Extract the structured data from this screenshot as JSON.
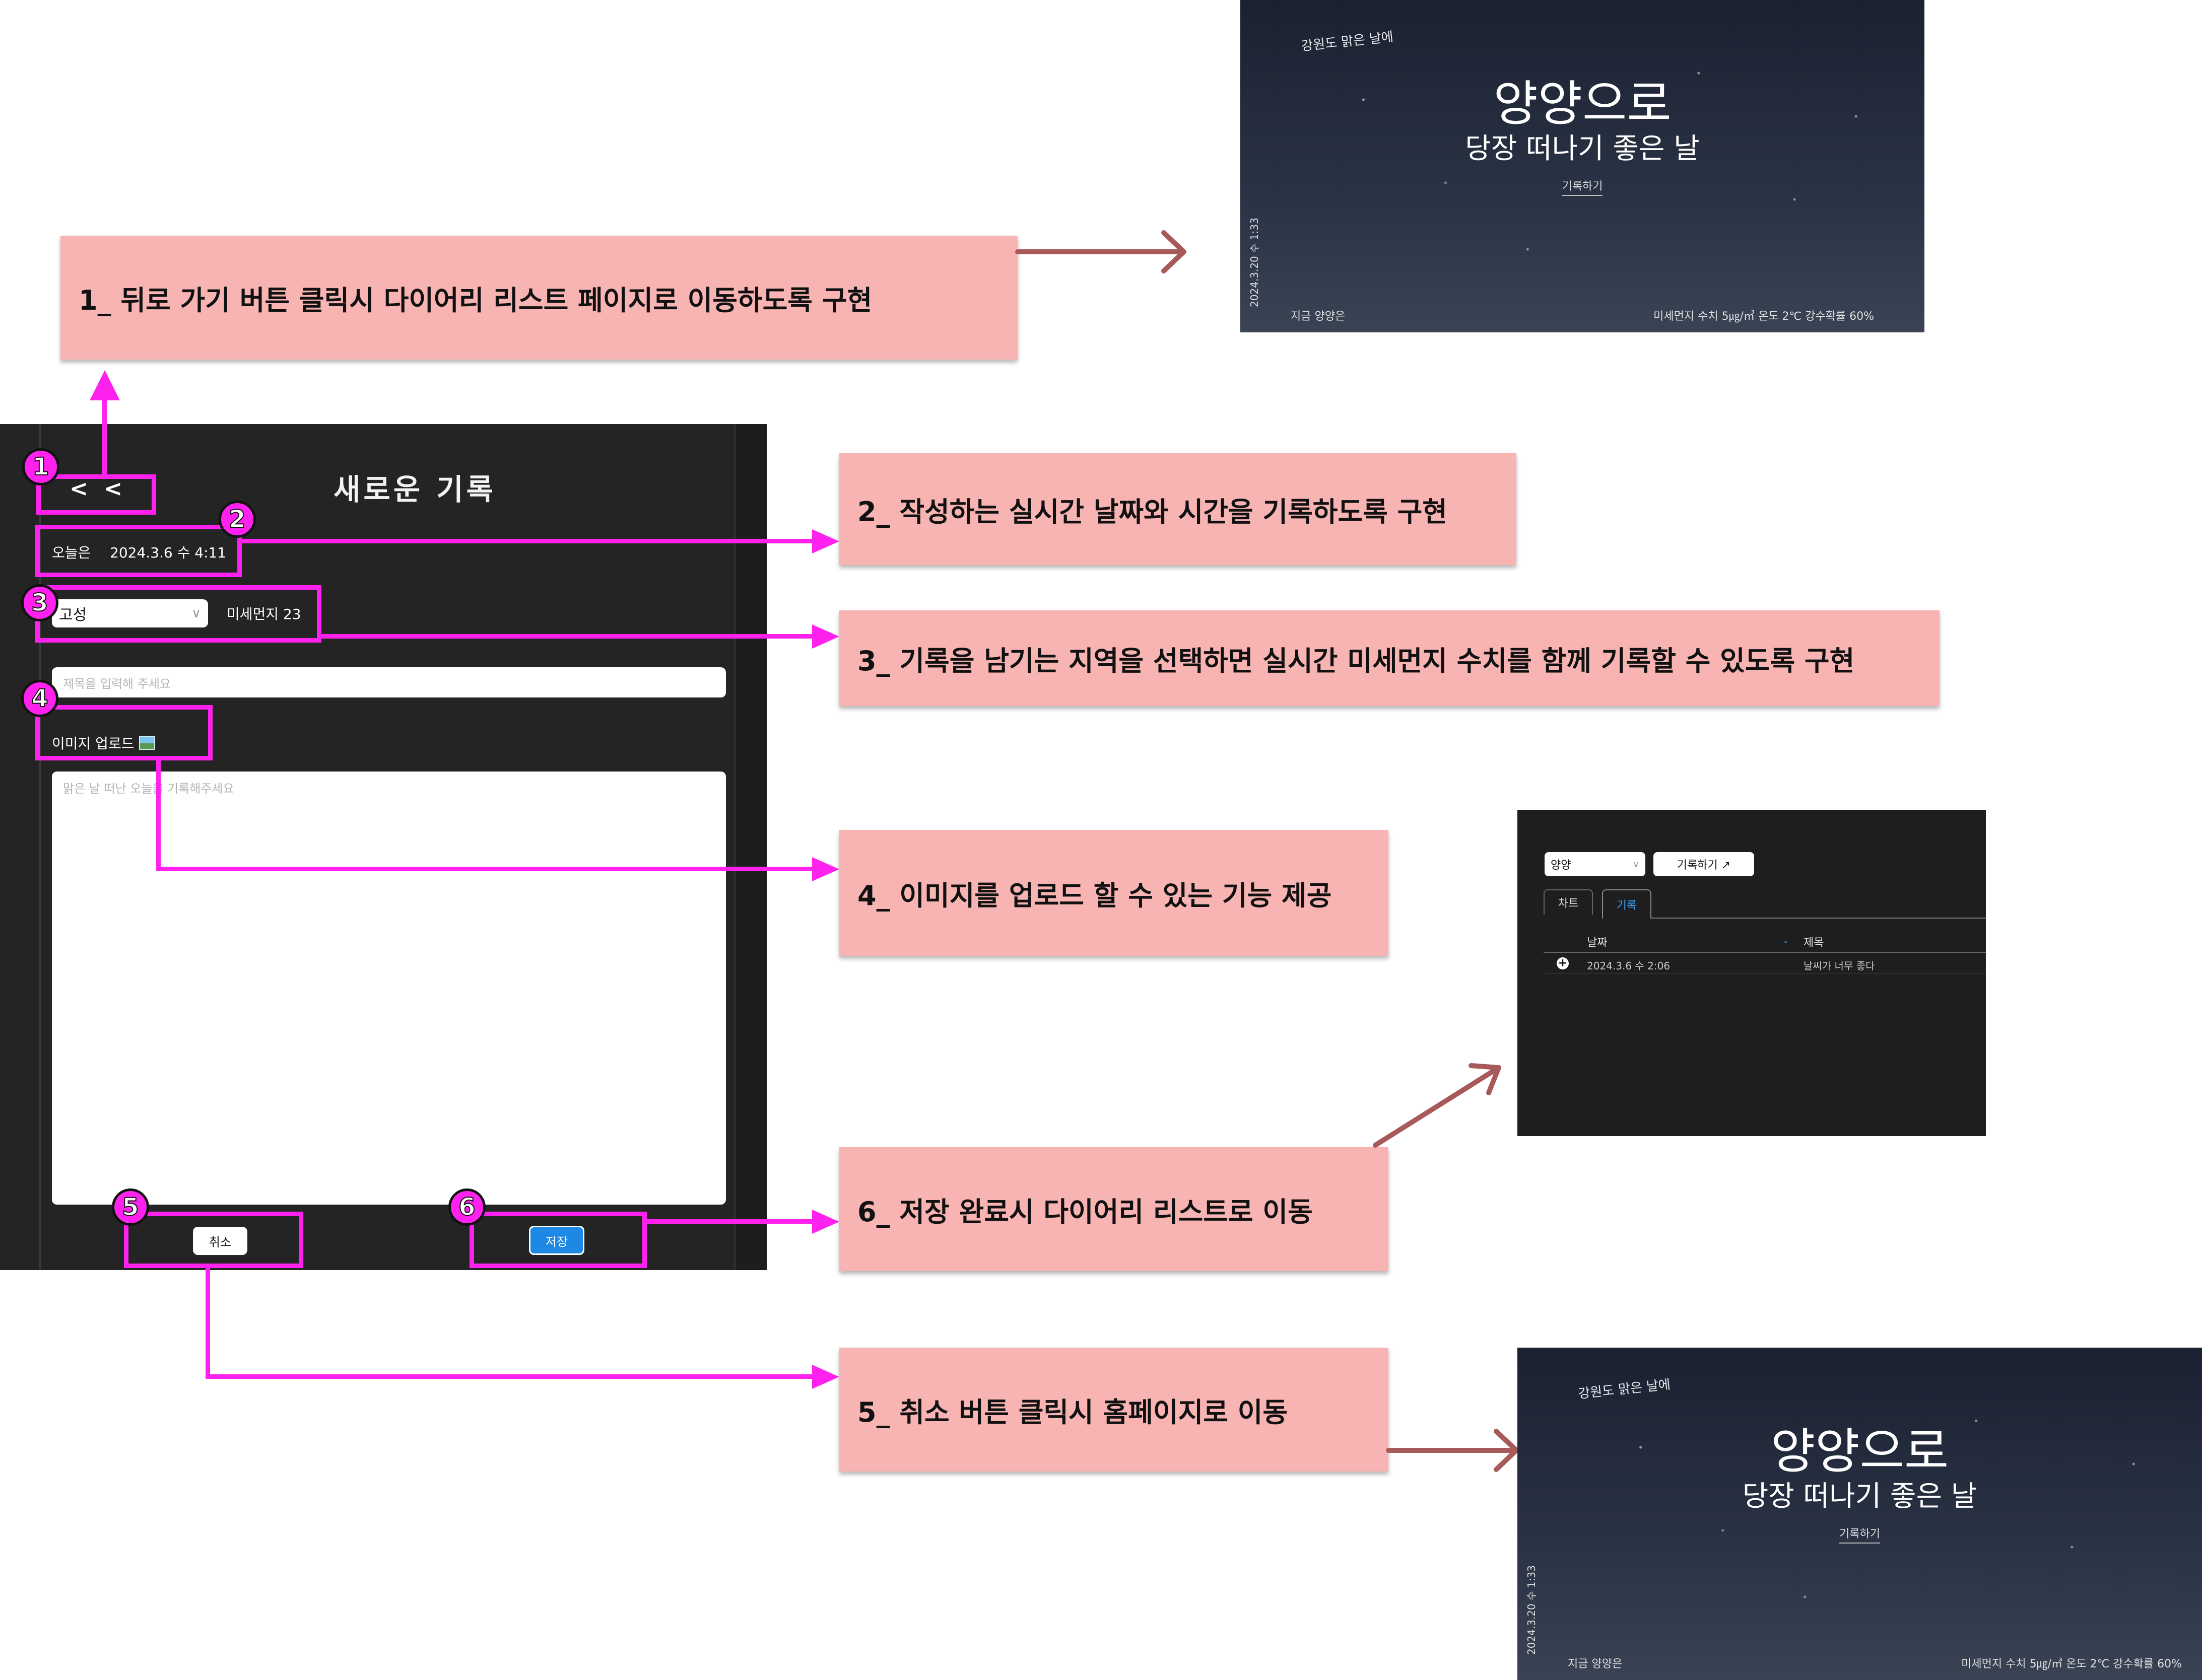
{
  "app": {
    "back_label": "< <",
    "title": "새로운 기록",
    "date_label": "오늘은",
    "date_value": "2024.3.6 수 4:11",
    "region_selected": "고성",
    "dust_label": "미세먼지 23",
    "title_placeholder": "제목을 입력해 주세요",
    "image_upload_label": "이미지 업로드",
    "content_placeholder": "맑은 날 떠난 오늘을 기록해주세요",
    "cancel_label": "취소",
    "save_label": "저장"
  },
  "annotations": {
    "badges": [
      "1",
      "2",
      "3",
      "4",
      "5",
      "6"
    ],
    "notes": [
      "1_ 뒤로 가기 버튼 클릭시 다이어리 리스트 페이지로 이동하도록 구현",
      "2_ 작성하는 실시간 날짜와 시간을 기록하도록 구현",
      "3_ 기록을 남기는 지역을 선택하면 실시간 미세먼지 수치를 함께 기록할 수 있도록 구현",
      "4_ 이미지를 업로드 할 수 있는 기능 제공",
      "6_ 저장 완료시 다이어리 리스트로 이동",
      "5_ 취소 버튼 클릭시 홈페이지로 이동"
    ]
  },
  "hero": {
    "tagline": "강원도 맑은 날에",
    "title": "양양으로",
    "subtitle": "당장 떠나기 좋은 날",
    "record_link": "기록하기",
    "side_date": "2024.3.20 수 1:33",
    "now_label": "지금 양양은",
    "stats": "미세먼지 수치 5㎍/㎥  온도 2℃  강수확률 60%"
  },
  "diary_list": {
    "region_selected": "양양",
    "record_button": "기록하기 ↗",
    "tabs": [
      "차트",
      "기록"
    ],
    "active_tab": "기록",
    "columns": [
      "날짜",
      "제목"
    ],
    "rows": [
      {
        "date": "2024.3.6 수 2:06",
        "title": "날씨가 너무 좋다"
      }
    ]
  },
  "colors": {
    "annotation_magenta": "#ff22ee",
    "note_pink": "#f7b4b2",
    "arrow_brown": "#a85a5a",
    "app_bg": "#242424",
    "save_blue": "#1e88e5"
  }
}
